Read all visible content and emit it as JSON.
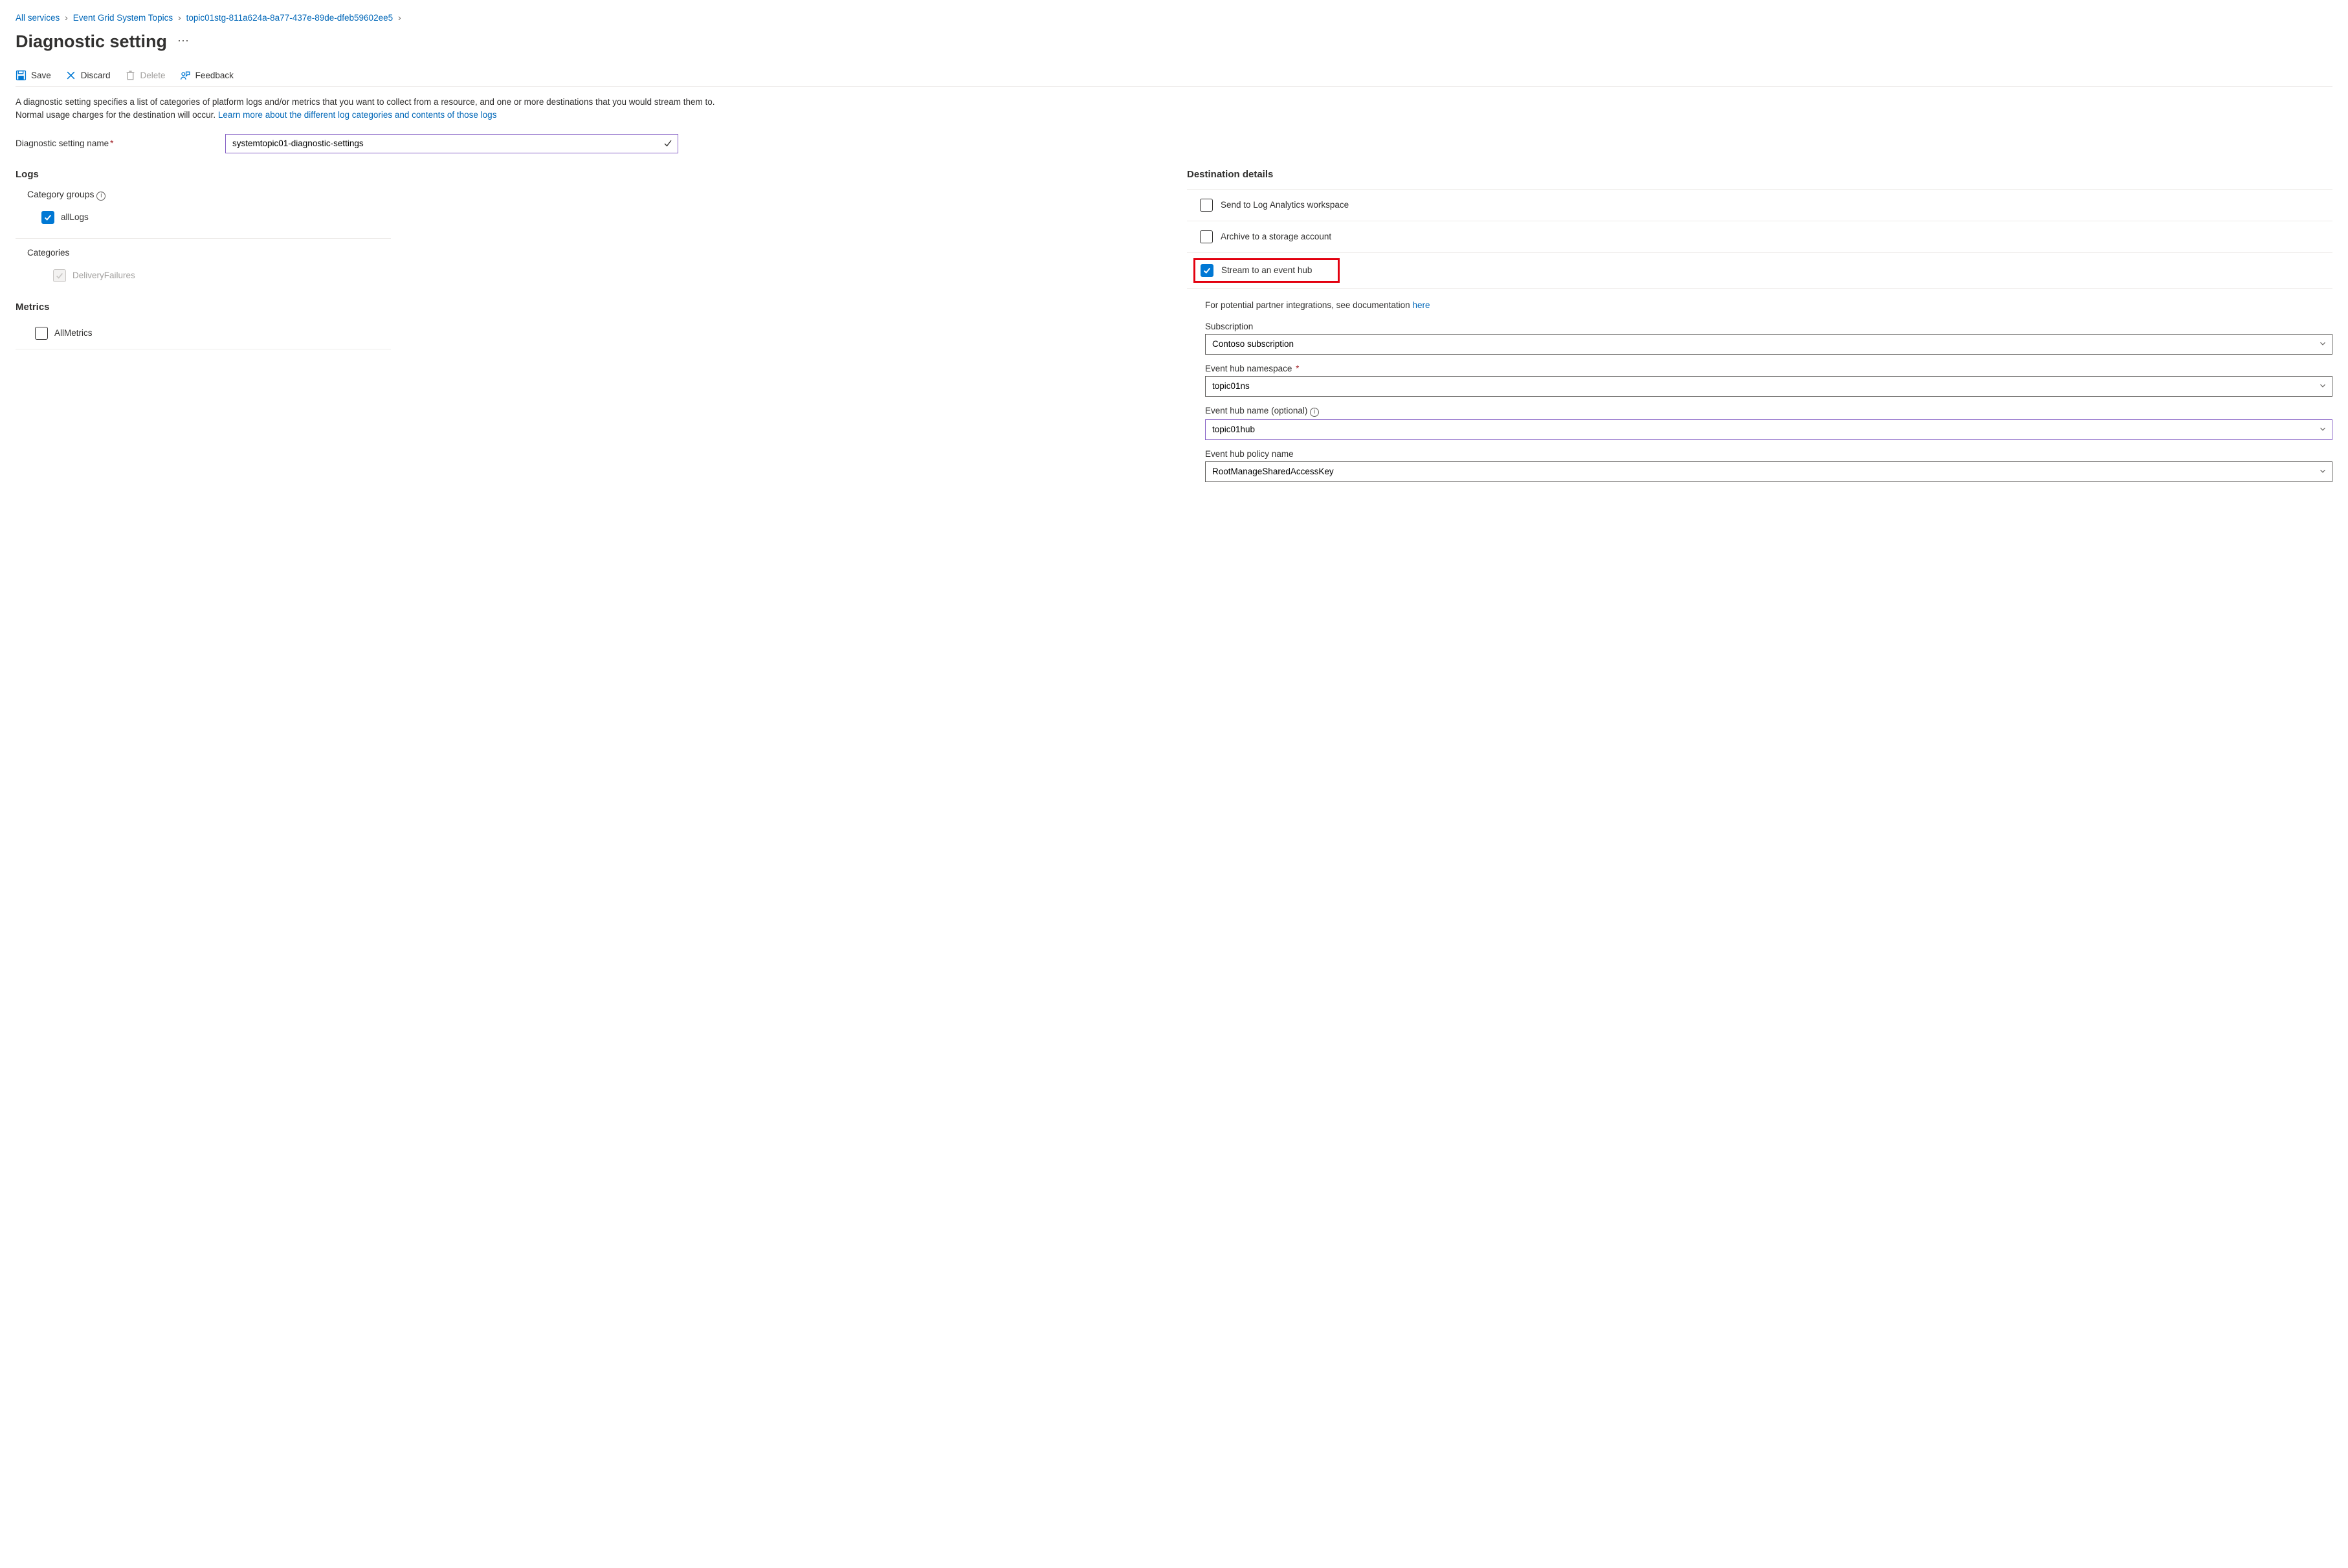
{
  "breadcrumb": {
    "items": [
      "All services",
      "Event Grid System Topics",
      "topic01stg-811a624a-8a77-437e-89de-dfeb59602ee5"
    ]
  },
  "header": {
    "title": "Diagnostic setting"
  },
  "toolbar": {
    "save": "Save",
    "discard": "Discard",
    "delete": "Delete",
    "feedback": "Feedback"
  },
  "description": {
    "text1": "A diagnostic setting specifies a list of categories of platform logs and/or metrics that you want to collect from a resource, and one or more destinations that you would stream them to. Normal usage charges for the destination will occur. ",
    "link": "Learn more about the different log categories and contents of those logs"
  },
  "form": {
    "name_label": "Diagnostic setting name",
    "name_value": "systemtopic01-diagnostic-settings"
  },
  "logs": {
    "heading": "Logs",
    "category_groups_label": "Category groups",
    "allLogs_label": "allLogs",
    "categories_label": "Categories",
    "deliveryFailures_label": "DeliveryFailures"
  },
  "metrics": {
    "heading": "Metrics",
    "allMetrics_label": "AllMetrics"
  },
  "destination": {
    "heading": "Destination details",
    "log_analytics": "Send to Log Analytics workspace",
    "archive_storage": "Archive to a storage account",
    "event_hub": "Stream to an event hub",
    "partner_text": "For potential partner integrations, see documentation ",
    "partner_link": "here",
    "subscription_label": "Subscription",
    "subscription_value": "Contoso subscription",
    "namespace_label": "Event hub namespace",
    "namespace_value": "topic01ns",
    "hubname_label": "Event hub name (optional)",
    "hubname_value": "topic01hub",
    "policy_label": "Event hub policy name",
    "policy_value": "RootManageSharedAccessKey"
  }
}
